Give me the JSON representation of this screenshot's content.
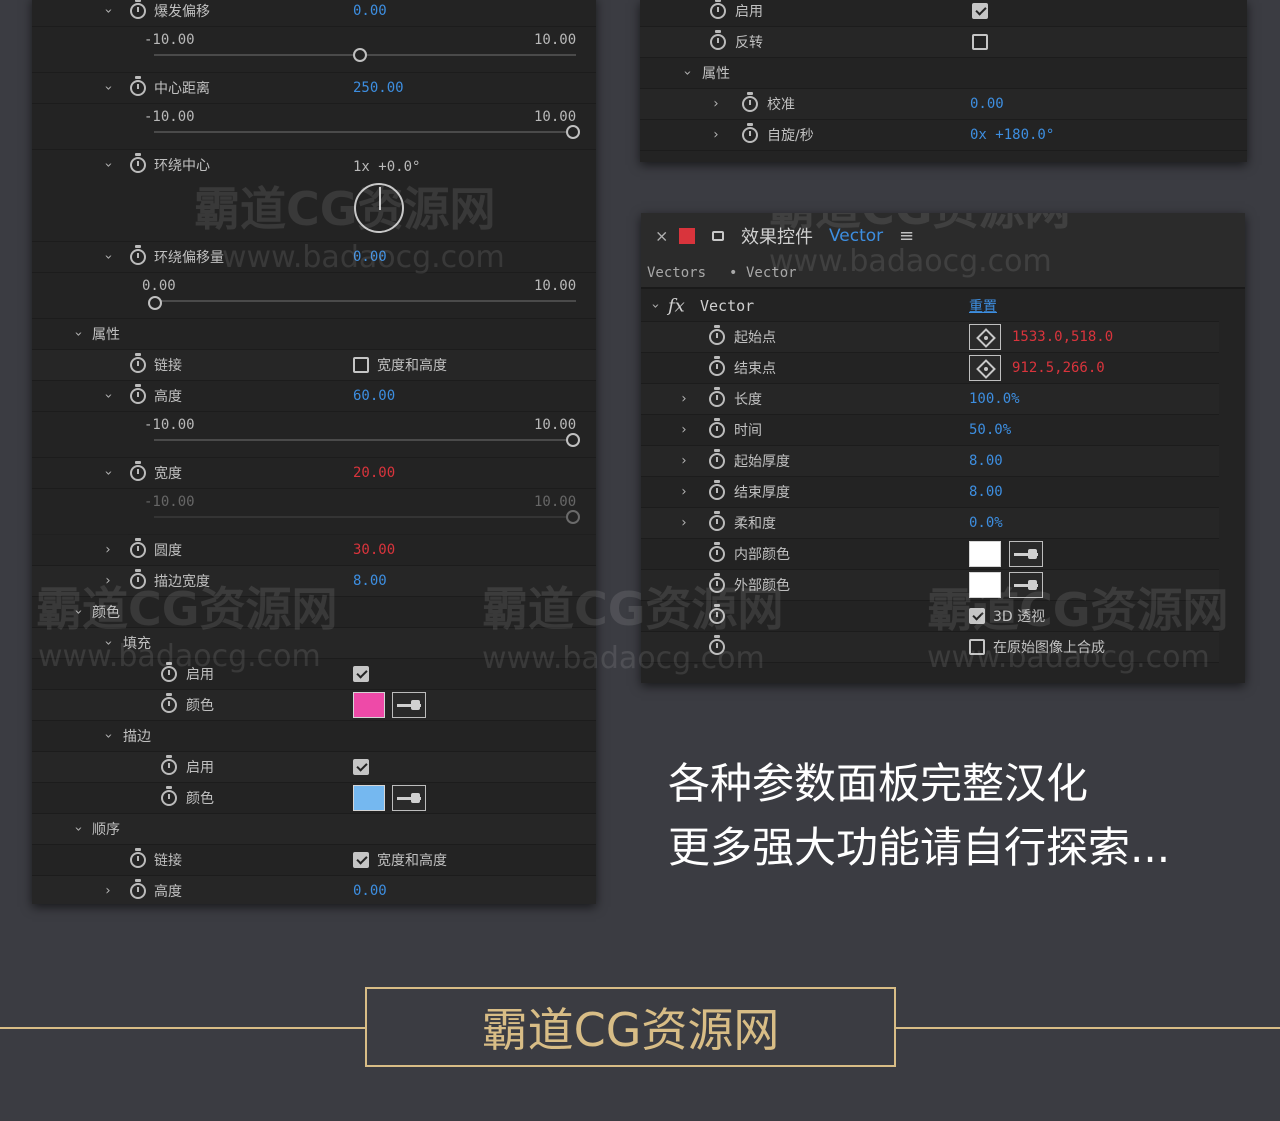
{
  "left_panel": {
    "rows": [
      {
        "label": "爆发偏移",
        "value": "0.00"
      },
      {
        "min": "-10.00",
        "max": "10.00"
      },
      {
        "label": "中心距离",
        "value": "250.00"
      },
      {
        "min": "-10.00",
        "max": "10.00"
      },
      {
        "label": "环绕中心",
        "value": "1x +0.0°"
      },
      {
        "label": "环绕偏移量",
        "value": "0.00"
      },
      {
        "min": "0.00",
        "max": "10.00"
      },
      {
        "label": "属性"
      },
      {
        "label": "链接",
        "checkbox_label": "宽度和高度"
      },
      {
        "label": "高度",
        "value": "60.00"
      },
      {
        "min": "-10.00",
        "max": "10.00"
      },
      {
        "label": "宽度",
        "value": "20.00"
      },
      {
        "min": "-10.00",
        "max": "10.00"
      },
      {
        "label": "圆度",
        "value": "30.00"
      },
      {
        "label": "描边宽度",
        "value": "8.00"
      },
      {
        "label": "颜色"
      },
      {
        "label": "填充"
      },
      {
        "label": "启用"
      },
      {
        "label": "颜色"
      },
      {
        "label": "描边"
      },
      {
        "label": "启用"
      },
      {
        "label": "颜色"
      },
      {
        "label": "顺序"
      },
      {
        "label": "链接",
        "checkbox_label": "宽度和高度"
      },
      {
        "label": "高度",
        "value": "0.00"
      }
    ],
    "fill_color": "#ee4aa8",
    "stroke_color": "#75b8f0"
  },
  "top_right_panel": {
    "rows": [
      {
        "label": "启用"
      },
      {
        "label": "反转"
      },
      {
        "label": "属性"
      },
      {
        "label": "校准",
        "value": "0.00"
      },
      {
        "label": "自旋/秒",
        "value": "0x +180.0°"
      }
    ]
  },
  "vector_panel": {
    "header": {
      "close": "×",
      "title": "效果控件",
      "title_accent": "Vector",
      "menu": "≡"
    },
    "crumb": {
      "left": "Vectors",
      "sep": "•",
      "right": "Vector"
    },
    "effect_name": "Vector",
    "reset": "重置",
    "rows": [
      {
        "label": "起始点",
        "value": "1533.0,518.0"
      },
      {
        "label": "结束点",
        "value": "912.5,266.0"
      },
      {
        "label": "长度",
        "value": "100.0%"
      },
      {
        "label": "时间",
        "value": "50.0%"
      },
      {
        "label": "起始厚度",
        "value": "8.00"
      },
      {
        "label": "结束厚度",
        "value": "8.00"
      },
      {
        "label": "柔和度",
        "value": "0.0%"
      },
      {
        "label": "内部颜色"
      },
      {
        "label": "外部颜色"
      },
      {
        "checkbox_label": "3D 透视"
      },
      {
        "checkbox_label": "在原始图像上合成"
      }
    ],
    "inner_color": "#ffffff",
    "outer_color": "#ffffff"
  },
  "watermark": {
    "name": "霸道CG资源网",
    "url": "www.badaocg.com"
  },
  "caption": {
    "line1": "各种参数面板完整汉化",
    "line2": "更多强大功能请自行探索..."
  },
  "brand": "霸道CG资源网",
  "colors": {
    "background": "#3b3c42",
    "panel": "#232323",
    "accent_blue": "#3d8ee0",
    "accent_red": "#d9343c",
    "brand_gold": "#d8bd86"
  }
}
